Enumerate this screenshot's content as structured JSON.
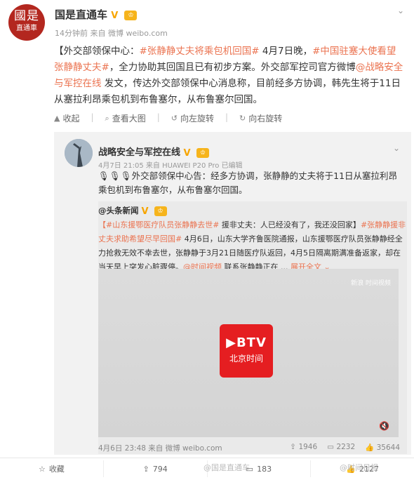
{
  "header": {
    "avatar_big": "國是",
    "avatar_small": "直通車",
    "author": "国是直通车",
    "meta": "14分钟前 来自 微博 weibo.com"
  },
  "post": {
    "text_a": "【外交部领保中心：",
    "tag1": "#张静静丈夫将乘包机回国#",
    "text_b": " 4月7日晚，",
    "tag2": "#中国驻塞大使看望张静静丈夫#",
    "text_c": "，全力协助其回国且已有初步方案。外交部军控司官方微博",
    "mention": "@战略安全与军控在线",
    "text_d": " 发文，传达外交部领保中心消息称，目前经多方协调，韩先生将于11日从塞拉利昂乘包机到布鲁塞尔，从布鲁塞尔回国。"
  },
  "tools": {
    "collapse": "收起",
    "view_large": "查看大图",
    "rotate_left": "向左旋转",
    "rotate_right": "向右旋转"
  },
  "repost": {
    "author": "战略安全与军控在线",
    "meta": "4月7日 21:05 来自 HUAWEI P20 Pro  已编辑",
    "text": "外交部领保中心告：经多方协调，张静静的丈夫将于11日从塞拉利昂乘包机到布鲁塞尔，从布鲁塞尔回国。",
    "emoji": "🎙🎙🎙"
  },
  "inner": {
    "author": "@头条新闻",
    "tag1": "【#山东援鄂医疗队员张静静去世#",
    "text_a": " 援非丈夫：人已经没有了，我还没回家】",
    "tag2": "#张静静援非丈夫求助希望尽早回国#",
    "text_b": " 4月6日，山东大学齐鲁医院通报，山东援鄂医疗队员张静静经全力抢救无效不幸去世，张静静于3月21日随医疗队返回，4月5日隔离期满准备返家，却在当天早上突发心脏骤停。",
    "link": "@时间视频",
    "text_c": " 联系张静静正在 ...",
    "expand": "展开全文 ⌄",
    "foot_meta": "4月6日 23:48 来自 微博 weibo.com",
    "forwards": "1946",
    "comments": "2232",
    "likes": "35644"
  },
  "video": {
    "logo_main": "▶BTV",
    "logo_sub": "北京时间",
    "watermark": "新浪 时间视频"
  },
  "bottom": {
    "favorite": "收藏",
    "forward": "794",
    "comment": "183",
    "like": "2127"
  },
  "watermarks": {
    "a": "@国是直通车",
    "b": "@时间日报"
  },
  "colors": {
    "link": "#eb7350",
    "accent": "#f7a500",
    "brand_red": "#b3271f"
  }
}
